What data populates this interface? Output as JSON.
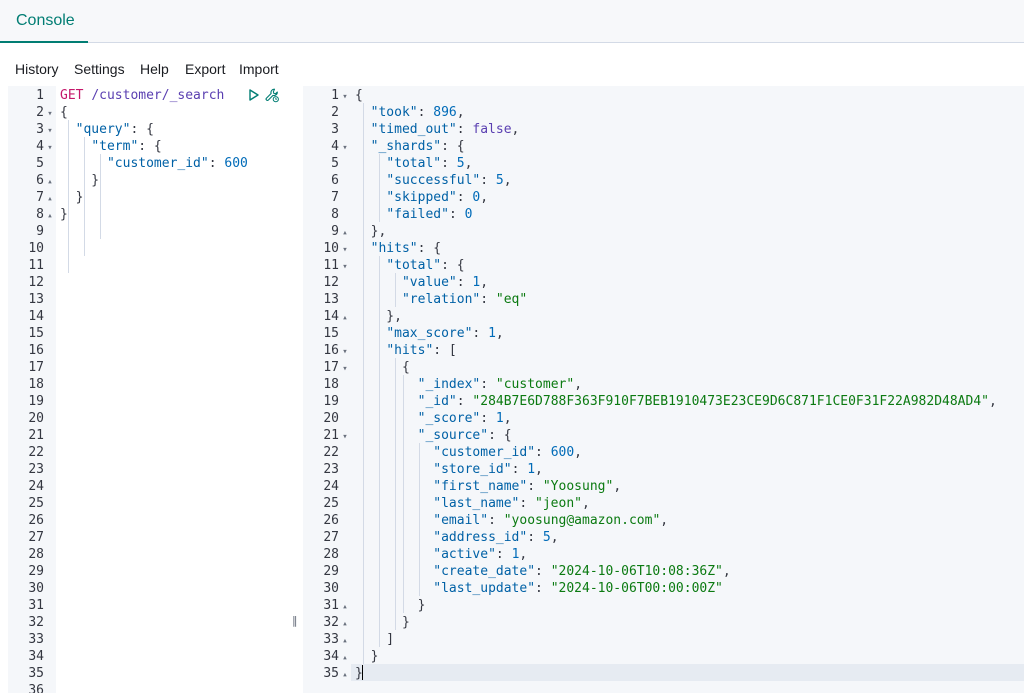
{
  "tabs": [
    {
      "label": "Console"
    }
  ],
  "menu": [
    {
      "label": "History"
    },
    {
      "label": "Settings"
    },
    {
      "label": "Help"
    },
    {
      "label": "Export"
    },
    {
      "label": "Import"
    }
  ],
  "request": {
    "method": "GET",
    "path": "/customer/_search",
    "line_count": 36,
    "lines": [
      [
        {
          "t": "m",
          "v": "GET"
        },
        {
          "t": "p",
          "v": " "
        },
        {
          "t": "u",
          "v": "/customer/_search"
        }
      ],
      [
        {
          "t": "p",
          "v": "{"
        }
      ],
      [
        {
          "t": "p",
          "v": "  "
        },
        {
          "t": "k",
          "v": "\"query\""
        },
        {
          "t": "p",
          "v": ": {"
        }
      ],
      [
        {
          "t": "p",
          "v": "    "
        },
        {
          "t": "k",
          "v": "\"term\""
        },
        {
          "t": "p",
          "v": ": {"
        }
      ],
      [
        {
          "t": "p",
          "v": "      "
        },
        {
          "t": "k",
          "v": "\"customer_id\""
        },
        {
          "t": "p",
          "v": ": "
        },
        {
          "t": "n",
          "v": "600"
        }
      ],
      [
        {
          "t": "p",
          "v": "    }"
        }
      ],
      [
        {
          "t": "p",
          "v": "  }"
        }
      ],
      [
        {
          "t": "p",
          "v": "}"
        }
      ]
    ],
    "folds": {
      "2": "open",
      "3": "open",
      "4": "open",
      "6": "close",
      "7": "close",
      "8": "close"
    }
  },
  "response": {
    "line_count": 35,
    "lines": [
      [
        {
          "t": "p",
          "v": "{"
        }
      ],
      [
        {
          "t": "p",
          "v": "  "
        },
        {
          "t": "k",
          "v": "\"took\""
        },
        {
          "t": "p",
          "v": ": "
        },
        {
          "t": "n",
          "v": "896"
        },
        {
          "t": "p",
          "v": ","
        }
      ],
      [
        {
          "t": "p",
          "v": "  "
        },
        {
          "t": "k",
          "v": "\"timed_out\""
        },
        {
          "t": "p",
          "v": ": "
        },
        {
          "t": "b",
          "v": "false"
        },
        {
          "t": "p",
          "v": ","
        }
      ],
      [
        {
          "t": "p",
          "v": "  "
        },
        {
          "t": "k",
          "v": "\"_shards\""
        },
        {
          "t": "p",
          "v": ": {"
        }
      ],
      [
        {
          "t": "p",
          "v": "    "
        },
        {
          "t": "k",
          "v": "\"total\""
        },
        {
          "t": "p",
          "v": ": "
        },
        {
          "t": "n",
          "v": "5"
        },
        {
          "t": "p",
          "v": ","
        }
      ],
      [
        {
          "t": "p",
          "v": "    "
        },
        {
          "t": "k",
          "v": "\"successful\""
        },
        {
          "t": "p",
          "v": ": "
        },
        {
          "t": "n",
          "v": "5"
        },
        {
          "t": "p",
          "v": ","
        }
      ],
      [
        {
          "t": "p",
          "v": "    "
        },
        {
          "t": "k",
          "v": "\"skipped\""
        },
        {
          "t": "p",
          "v": ": "
        },
        {
          "t": "n",
          "v": "0"
        },
        {
          "t": "p",
          "v": ","
        }
      ],
      [
        {
          "t": "p",
          "v": "    "
        },
        {
          "t": "k",
          "v": "\"failed\""
        },
        {
          "t": "p",
          "v": ": "
        },
        {
          "t": "n",
          "v": "0"
        }
      ],
      [
        {
          "t": "p",
          "v": "  },"
        }
      ],
      [
        {
          "t": "p",
          "v": "  "
        },
        {
          "t": "k",
          "v": "\"hits\""
        },
        {
          "t": "p",
          "v": ": {"
        }
      ],
      [
        {
          "t": "p",
          "v": "    "
        },
        {
          "t": "k",
          "v": "\"total\""
        },
        {
          "t": "p",
          "v": ": {"
        }
      ],
      [
        {
          "t": "p",
          "v": "      "
        },
        {
          "t": "k",
          "v": "\"value\""
        },
        {
          "t": "p",
          "v": ": "
        },
        {
          "t": "n",
          "v": "1"
        },
        {
          "t": "p",
          "v": ","
        }
      ],
      [
        {
          "t": "p",
          "v": "      "
        },
        {
          "t": "k",
          "v": "\"relation\""
        },
        {
          "t": "p",
          "v": ": "
        },
        {
          "t": "s",
          "v": "\"eq\""
        }
      ],
      [
        {
          "t": "p",
          "v": "    },"
        }
      ],
      [
        {
          "t": "p",
          "v": "    "
        },
        {
          "t": "k",
          "v": "\"max_score\""
        },
        {
          "t": "p",
          "v": ": "
        },
        {
          "t": "n",
          "v": "1"
        },
        {
          "t": "p",
          "v": ","
        }
      ],
      [
        {
          "t": "p",
          "v": "    "
        },
        {
          "t": "k",
          "v": "\"hits\""
        },
        {
          "t": "p",
          "v": ": ["
        }
      ],
      [
        {
          "t": "p",
          "v": "      {"
        }
      ],
      [
        {
          "t": "p",
          "v": "        "
        },
        {
          "t": "k",
          "v": "\"_index\""
        },
        {
          "t": "p",
          "v": ": "
        },
        {
          "t": "s",
          "v": "\"customer\""
        },
        {
          "t": "p",
          "v": ","
        }
      ],
      [
        {
          "t": "p",
          "v": "        "
        },
        {
          "t": "k",
          "v": "\"_id\""
        },
        {
          "t": "p",
          "v": ": "
        },
        {
          "t": "s",
          "v": "\"284B7E6D788F363F910F7BEB1910473E23CE9D6C871F1CE0F31F22A982D48AD4\""
        },
        {
          "t": "p",
          "v": ","
        }
      ],
      [
        {
          "t": "p",
          "v": "        "
        },
        {
          "t": "k",
          "v": "\"_score\""
        },
        {
          "t": "p",
          "v": ": "
        },
        {
          "t": "n",
          "v": "1"
        },
        {
          "t": "p",
          "v": ","
        }
      ],
      [
        {
          "t": "p",
          "v": "        "
        },
        {
          "t": "k",
          "v": "\"_source\""
        },
        {
          "t": "p",
          "v": ": {"
        }
      ],
      [
        {
          "t": "p",
          "v": "          "
        },
        {
          "t": "k",
          "v": "\"customer_id\""
        },
        {
          "t": "p",
          "v": ": "
        },
        {
          "t": "n",
          "v": "600"
        },
        {
          "t": "p",
          "v": ","
        }
      ],
      [
        {
          "t": "p",
          "v": "          "
        },
        {
          "t": "k",
          "v": "\"store_id\""
        },
        {
          "t": "p",
          "v": ": "
        },
        {
          "t": "n",
          "v": "1"
        },
        {
          "t": "p",
          "v": ","
        }
      ],
      [
        {
          "t": "p",
          "v": "          "
        },
        {
          "t": "k",
          "v": "\"first_name\""
        },
        {
          "t": "p",
          "v": ": "
        },
        {
          "t": "s",
          "v": "\"Yoosung\""
        },
        {
          "t": "p",
          "v": ","
        }
      ],
      [
        {
          "t": "p",
          "v": "          "
        },
        {
          "t": "k",
          "v": "\"last_name\""
        },
        {
          "t": "p",
          "v": ": "
        },
        {
          "t": "s",
          "v": "\"jeon\""
        },
        {
          "t": "p",
          "v": ","
        }
      ],
      [
        {
          "t": "p",
          "v": "          "
        },
        {
          "t": "k",
          "v": "\"email\""
        },
        {
          "t": "p",
          "v": ": "
        },
        {
          "t": "s",
          "v": "\"yoosung@amazon.com\""
        },
        {
          "t": "p",
          "v": ","
        }
      ],
      [
        {
          "t": "p",
          "v": "          "
        },
        {
          "t": "k",
          "v": "\"address_id\""
        },
        {
          "t": "p",
          "v": ": "
        },
        {
          "t": "n",
          "v": "5"
        },
        {
          "t": "p",
          "v": ","
        }
      ],
      [
        {
          "t": "p",
          "v": "          "
        },
        {
          "t": "k",
          "v": "\"active\""
        },
        {
          "t": "p",
          "v": ": "
        },
        {
          "t": "n",
          "v": "1"
        },
        {
          "t": "p",
          "v": ","
        }
      ],
      [
        {
          "t": "p",
          "v": "          "
        },
        {
          "t": "k",
          "v": "\"create_date\""
        },
        {
          "t": "p",
          "v": ": "
        },
        {
          "t": "s",
          "v": "\"2024-10-06T10:08:36Z\""
        },
        {
          "t": "p",
          "v": ","
        }
      ],
      [
        {
          "t": "p",
          "v": "          "
        },
        {
          "t": "k",
          "v": "\"last_update\""
        },
        {
          "t": "p",
          "v": ": "
        },
        {
          "t": "s",
          "v": "\"2024-10-06T00:00:00Z\""
        }
      ],
      [
        {
          "t": "p",
          "v": "        }"
        }
      ],
      [
        {
          "t": "p",
          "v": "      }"
        }
      ],
      [
        {
          "t": "p",
          "v": "    ]"
        }
      ],
      [
        {
          "t": "p",
          "v": "  }"
        }
      ],
      [
        {
          "t": "p",
          "v": "}"
        }
      ]
    ],
    "folds": {
      "1": "open",
      "4": "open",
      "9": "close",
      "10": "open",
      "11": "open",
      "14": "close",
      "16": "open",
      "17": "open",
      "21": "open",
      "31": "close",
      "32": "close",
      "33": "close",
      "34": "close",
      "35": "close"
    }
  },
  "icons": {
    "play": "play-icon",
    "wrench": "wrench-icon",
    "splitter": "splitter-handle-icon"
  },
  "colors": {
    "accent": "#017d73",
    "method": "#c5176a",
    "key": "#0061a6",
    "string": "#0b7a11"
  }
}
